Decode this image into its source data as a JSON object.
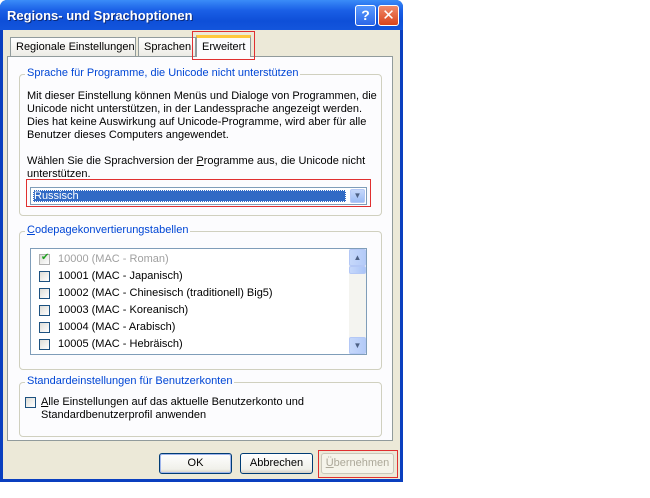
{
  "window": {
    "title": "Regions- und Sprachoptionen",
    "help_label": "?",
    "close_label": "✕"
  },
  "tabs": [
    {
      "label": "Regionale Einstellungen"
    },
    {
      "label": "Sprachen"
    },
    {
      "label": "Erweitert"
    }
  ],
  "unicode_group": {
    "label": "Sprache für Programme, die Unicode nicht unterstützen",
    "description": [
      "Mit dieser Einstellung können Menüs und Dialoge von Programmen, die",
      "Unicode nicht unterstützen, in der Landessprache angezeigt werden.",
      "Dies hat keine Auswirkung auf Unicode-Programme, wird aber für alle",
      "Benutzer dieses Computers angewendet."
    ],
    "prompt_line1_before": "Wählen Sie die Sprachversion der ",
    "prompt_line1_accel": "P",
    "prompt_line1_after": "rogramme aus, die Unicode nicht",
    "prompt_line2": "unterstützen.",
    "selected_language": "Russisch"
  },
  "codepage_group": {
    "label_accel": "C",
    "label_rest": "odepagekonvertierungstabellen",
    "items": [
      {
        "label": "10000 (MAC - Roman)",
        "checked": true,
        "disabled": true
      },
      {
        "label": "10001 (MAC - Japanisch)",
        "checked": false,
        "disabled": false
      },
      {
        "label": "10002 (MAC - Chinesisch (traditionell) Big5)",
        "checked": false,
        "disabled": false
      },
      {
        "label": "10003 (MAC - Koreanisch)",
        "checked": false,
        "disabled": false
      },
      {
        "label": "10004 (MAC - Arabisch)",
        "checked": false,
        "disabled": false
      },
      {
        "label": "10005 (MAC - Hebräisch)",
        "checked": false,
        "disabled": false
      }
    ]
  },
  "user_accounts_group": {
    "label": "Standardeinstellungen für Benutzerkonten",
    "checkbox_accel": "A",
    "checkbox_line1_rest": "lle Einstellungen auf das aktuelle Benutzerkonto und",
    "checkbox_line2": "Standardbenutzerprofil anwenden"
  },
  "buttons": {
    "ok": "OK",
    "cancel": "Abbrechen",
    "apply_accel": "Ü",
    "apply_rest": "bernehmen"
  }
}
